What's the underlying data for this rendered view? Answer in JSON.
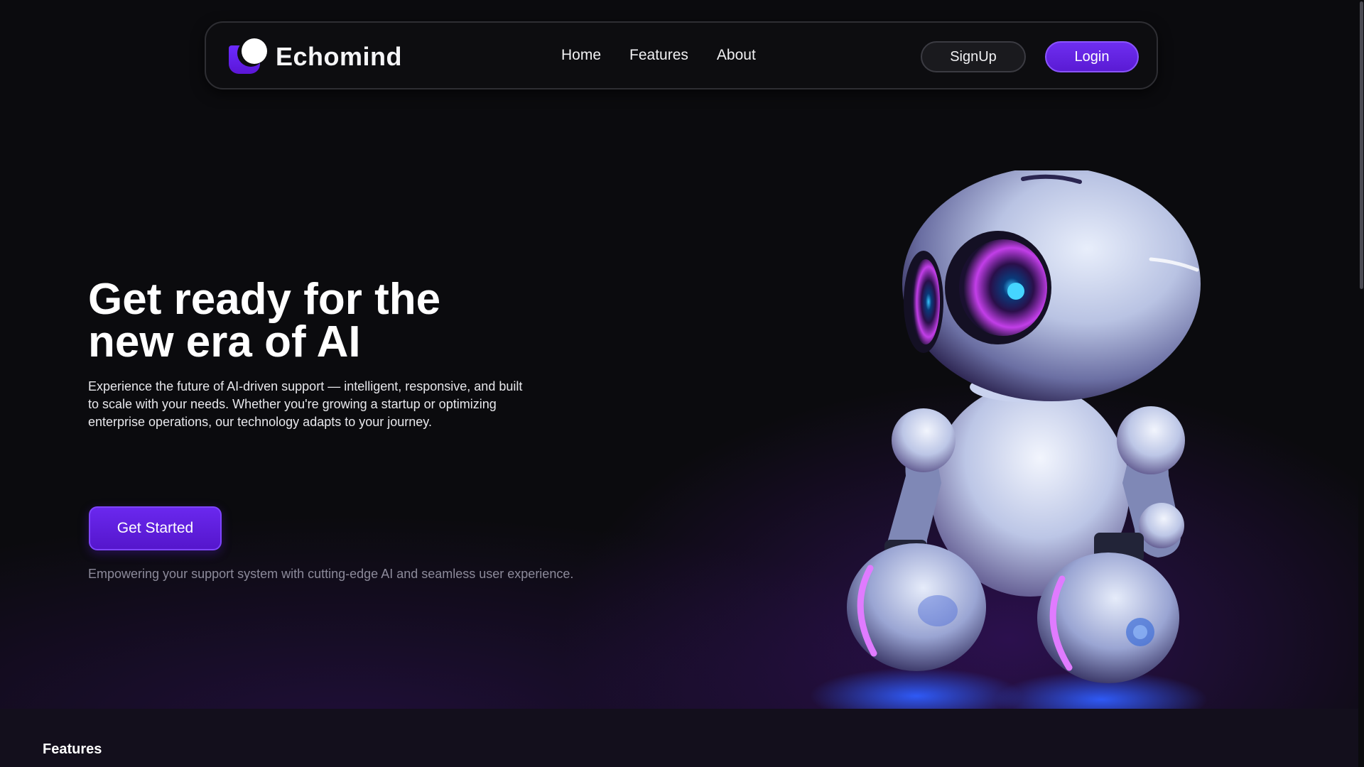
{
  "nav": {
    "brand": "Echomind",
    "links": [
      "Home",
      "Features",
      "About"
    ],
    "signup_label": "SignUp",
    "login_label": "Login"
  },
  "hero": {
    "title_line1": "Get ready for the",
    "title_line2": "new era of AI",
    "description": "Experience the future of AI-driven support — intelligent, responsive, and built to scale with your needs. Whether you're growing a startup or optimizing enterprise operations, our technology adapts to your journey.",
    "cta_label": "Get Started",
    "tagline": "Empowering your support system with cutting-edge AI and seamless user experience."
  },
  "features_section": {
    "heading": "Features"
  },
  "colors": {
    "background": "#0b0b0e",
    "accent": "#6a28ee",
    "accent_border": "#8a55ff",
    "muted_text": "#8c8a9a"
  },
  "icons": {
    "logo": "echomind-logo-icon"
  }
}
